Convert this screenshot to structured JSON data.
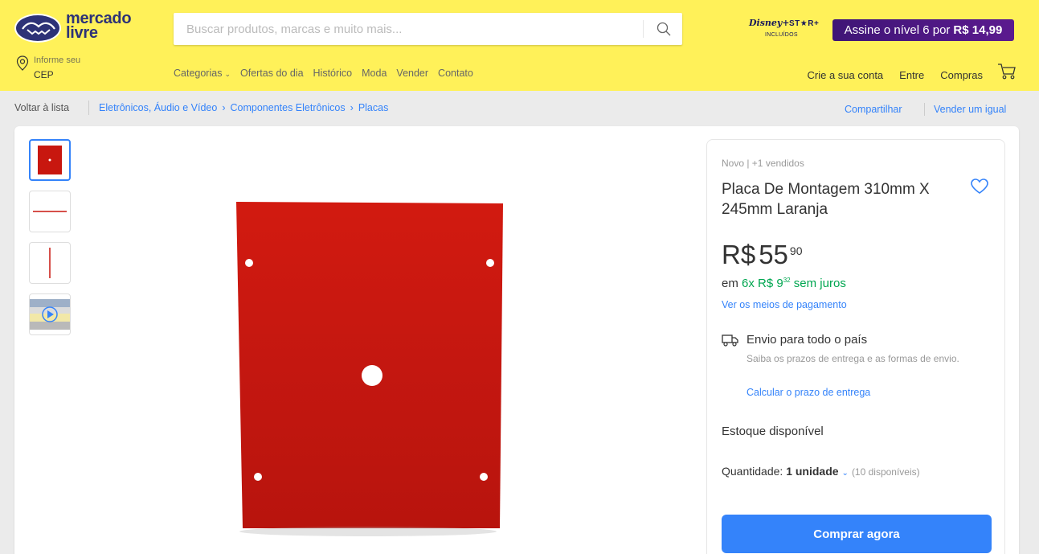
{
  "header": {
    "logo_text_line1": "mercado",
    "logo_text_line2": "livre",
    "search_placeholder": "Buscar produtos, marcas e muito mais...",
    "disney_text": "Disney+",
    "star_text": "ST★R+",
    "included_text": "INCLUÍDOS",
    "promo_text": "Assine o nível 6 por",
    "promo_price": "R$ 14,99",
    "location_small": "Informe seu",
    "location_big": "CEP",
    "nav": [
      {
        "label": "Categorias",
        "has_dropdown": true
      },
      {
        "label": "Ofertas do dia"
      },
      {
        "label": "Histórico"
      },
      {
        "label": "Moda"
      },
      {
        "label": "Vender"
      },
      {
        "label": "Contato"
      }
    ],
    "account": [
      "Crie a sua conta",
      "Entre",
      "Compras"
    ],
    "brand_color": "#fff159"
  },
  "breadcrumb": {
    "back": "Voltar à lista",
    "items": [
      "Eletrônicos, Áudio e Vídeo",
      "Componentes Eletrônicos",
      "Placas"
    ],
    "share": "Compartilhar",
    "sell_same": "Vender um igual"
  },
  "product": {
    "condition_sold": "Novo | +1 vendidos",
    "title": "Placa De Montagem 310mm X 245mm Laranja",
    "price_currency": "R$",
    "price_int": "55",
    "price_cents": "90",
    "installment_prefix": "em",
    "installment_value": "6x R$ 9",
    "installment_cents": "32",
    "installment_suffix": "sem juros",
    "payment_link": "Ver os meios de pagamento",
    "shipping_title": "Envio para todo o país",
    "shipping_desc": "Saiba os prazos de entrega e as formas de envio.",
    "shipping_link": "Calcular o prazo de entrega",
    "stock": "Estoque disponível",
    "quantity_label": "Quantidade:",
    "quantity_value": "1 unidade",
    "quantity_available": "(10 disponíveis)",
    "buy_button": "Comprar agora",
    "product_color": "#c8170f",
    "accent_color": "#3483fa",
    "green_color": "#00a650"
  },
  "thumbnails": [
    "plate-front",
    "plate-side-horizontal",
    "plate-side-vertical",
    "video"
  ]
}
